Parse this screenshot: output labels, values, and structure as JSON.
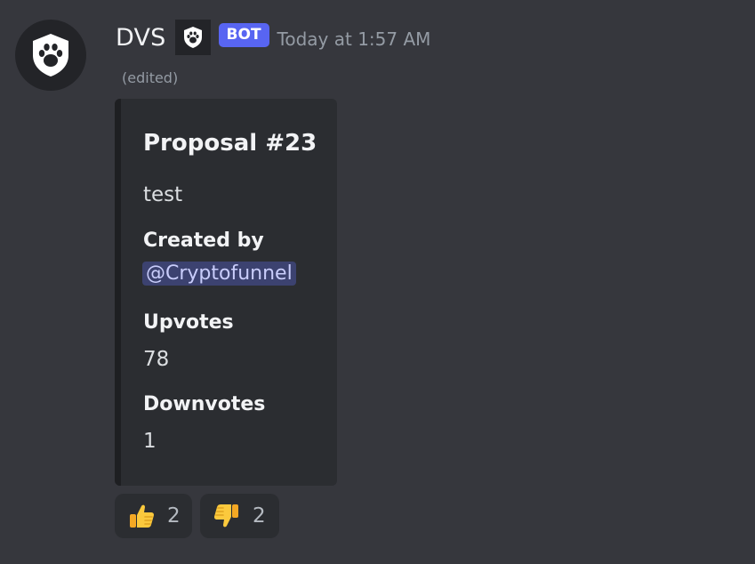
{
  "message": {
    "author": "DVS",
    "bot_tag": "BOT",
    "timestamp": "Today at 1:57 AM",
    "edited_label": "(edited)",
    "avatar_icon": "shield-paw-icon",
    "badge_icon": "shield-paw-icon"
  },
  "embed": {
    "title": "Proposal #23",
    "description": "test",
    "fields": [
      {
        "name": "Created by",
        "value": "@Cryptofunnel"
      },
      {
        "name": "Upvotes",
        "value": "78"
      },
      {
        "name": "Downvotes",
        "value": "1"
      }
    ]
  },
  "reactions": [
    {
      "emoji": "thumbs-up-icon",
      "count": "2"
    },
    {
      "emoji": "thumbs-down-icon",
      "count": "2"
    }
  ],
  "colors": {
    "background": "#36373d",
    "embed_background": "#2b2d31",
    "bot_tag": "#5865f2",
    "mention_background": "#3c4270",
    "mention_text": "#c9cdfb",
    "emoji_yellow": "#fbc93d"
  }
}
